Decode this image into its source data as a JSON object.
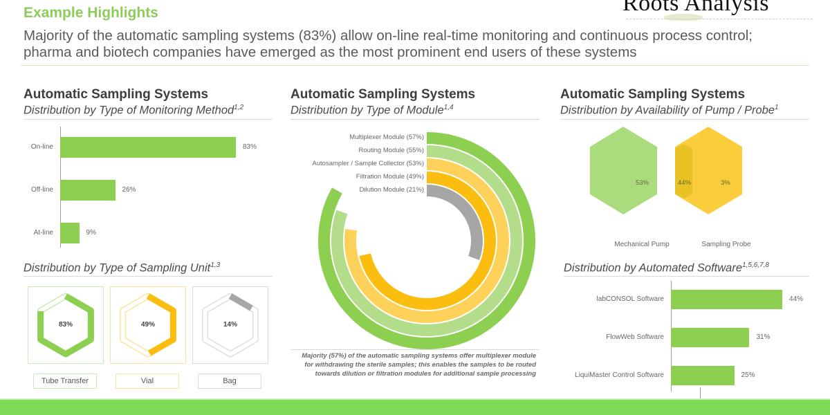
{
  "header": {
    "title": "Example Highlights",
    "text": "Majority of the automatic sampling systems (83%) allow on-line real-time monitoring and continuous process control; pharma and biotech companies have emerged as the most prominent end users of these systems",
    "brand": "Roots Analysis"
  },
  "colors": {
    "green": "#8dcf50",
    "light_green": "#b3dd8a",
    "light_orange": "#fdd15a",
    "orange": "#fbbd0f",
    "gray": "#a6a6a6",
    "footer": "#7ed957"
  },
  "panels": {
    "monitoring": {
      "title": "Automatic Sampling Systems",
      "subtitle": "Distribution by Type of Monitoring Method",
      "sup": "1,2"
    },
    "sampling_unit": {
      "subtitle": "Distribution by Type of Sampling Unit",
      "sup": "1,3"
    },
    "module": {
      "title": "Automatic Sampling Systems",
      "subtitle": "Distribution by Type of Module",
      "sup": "1,4",
      "note": "Majority (57%) of the automatic sampling systems offer multiplexer module for withdrawing the sterile samples; this enables the samples to be routed towards dilution or filtration modules for additional sample processing"
    },
    "pump_probe": {
      "title": "Automatic Sampling Systems",
      "subtitle": "Distribution by Availability of Pump / Probe",
      "sup": "1"
    },
    "software": {
      "subtitle": "Distribution by Automated Software",
      "sup": "1,5,6,7,8"
    }
  },
  "chart_data": [
    {
      "id": "monitoring",
      "type": "bar",
      "orientation": "horizontal",
      "title": "Distribution by Type of Monitoring Method",
      "categories": [
        "On-line",
        "Off-line",
        "At-line"
      ],
      "values": [
        83,
        26,
        9
      ],
      "labels": [
        "83%",
        "26%",
        "9%"
      ],
      "unit": "%",
      "xlim": [
        0,
        100
      ]
    },
    {
      "id": "sampling_unit",
      "type": "pie",
      "style": "hexagon-gauge",
      "title": "Distribution by Type of Sampling Unit",
      "categories": [
        "Tube Transfer",
        "Vial",
        "Bag"
      ],
      "values": [
        83,
        49,
        14
      ],
      "labels": [
        "83%",
        "49%",
        "14%"
      ],
      "series_colors": [
        "#8dcf50",
        "#fbbd0f",
        "#a6a6a6"
      ],
      "unit": "%"
    },
    {
      "id": "module",
      "type": "bar",
      "style": "radial",
      "title": "Distribution by Type of Module",
      "categories": [
        "Multiplexer Module",
        "Routing Module",
        "Autosampler / Sample Collector",
        "Filtration Module",
        "Dilution Module"
      ],
      "values": [
        57,
        55,
        53,
        49,
        21
      ],
      "labels": [
        "Multiplexer Module (57%)",
        "Routing Module (55%)",
        "Autosampler / Sample Collector (53%)",
        "Filtration Module (49%)",
        "Dilution Module (21%)"
      ],
      "series_colors": [
        "#8dcf50",
        "#b3dd8a",
        "#fdd15a",
        "#fbbd0f",
        "#a6a6a6"
      ],
      "unit": "%"
    },
    {
      "id": "pump_probe",
      "type": "pie",
      "style": "venn",
      "title": "Distribution by Availability of Pump / Probe",
      "sets": [
        "Mechanical Pump",
        "Sampling Probe"
      ],
      "values": {
        "Mechanical Pump only": 53,
        "Both": 44,
        "Sampling Probe only": 3
      },
      "labels": [
        "53%",
        "44%",
        "3%"
      ],
      "unit": "%"
    },
    {
      "id": "software",
      "type": "bar",
      "orientation": "horizontal",
      "title": "Distribution by Automated Software",
      "categories": [
        "labCONSOL Software",
        "FlowWeb Software",
        "LiquiMaster Control Software"
      ],
      "values": [
        44,
        31,
        25
      ],
      "labels": [
        "44%",
        "31%",
        "25%"
      ],
      "unit": "%",
      "xlim": [
        0,
        50
      ]
    }
  ]
}
